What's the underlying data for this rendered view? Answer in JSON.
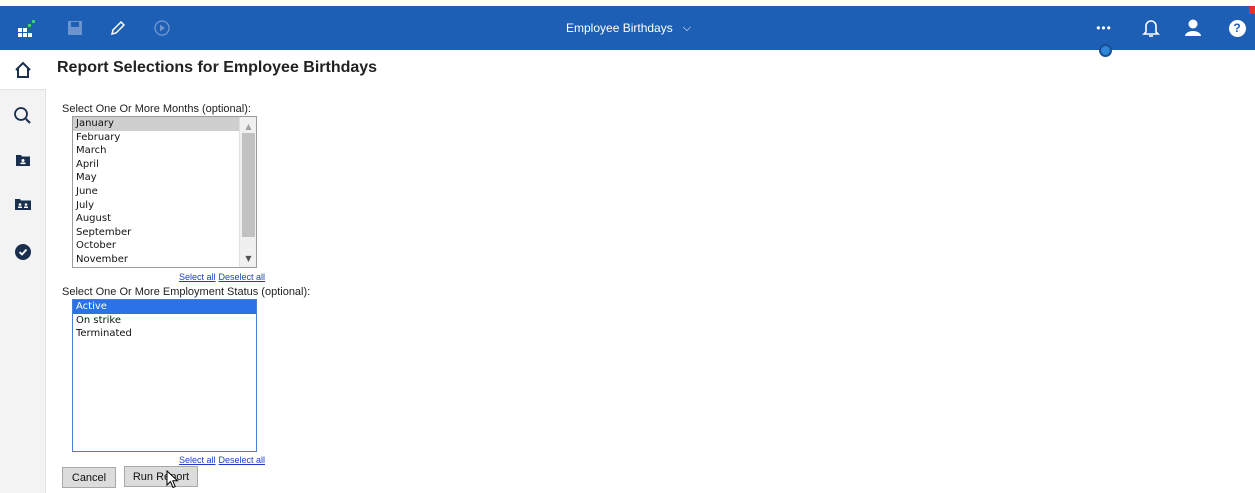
{
  "topbar": {
    "title": "Employee Birthdays",
    "icons": [
      "apps-icon",
      "save-icon",
      "edit-pencil-icon",
      "run-play-icon",
      "more-icon",
      "bell-icon",
      "user-icon",
      "help-icon"
    ],
    "dots": "•••",
    "help": "?"
  },
  "leftrail": {
    "items": [
      "home-icon",
      "search-icon",
      "my-content-folder-icon",
      "team-content-folder-icon",
      "recent-clock-icon"
    ]
  },
  "page": {
    "title": "Report Selections for Employee Birthdays"
  },
  "months": {
    "label": "Select One Or More Months (optional):",
    "options": [
      "January",
      "February",
      "March",
      "April",
      "May",
      "June",
      "July",
      "August",
      "September",
      "October",
      "November"
    ],
    "selected": "January",
    "select_all": "Select all",
    "deselect_all": "Deselect all"
  },
  "status": {
    "label": "Select One Or More Employment Status (optional):",
    "options": [
      "Active",
      "On strike",
      "Terminated"
    ],
    "selected": "Active",
    "select_all": "Select all",
    "deselect_all": "Deselect all"
  },
  "buttons": {
    "cancel": "Cancel",
    "run_report": "Run Report"
  },
  "colors": {
    "topbar": "#1d5fb5",
    "selected_blue": "#2a72e5",
    "link": "#1a3fbf"
  }
}
